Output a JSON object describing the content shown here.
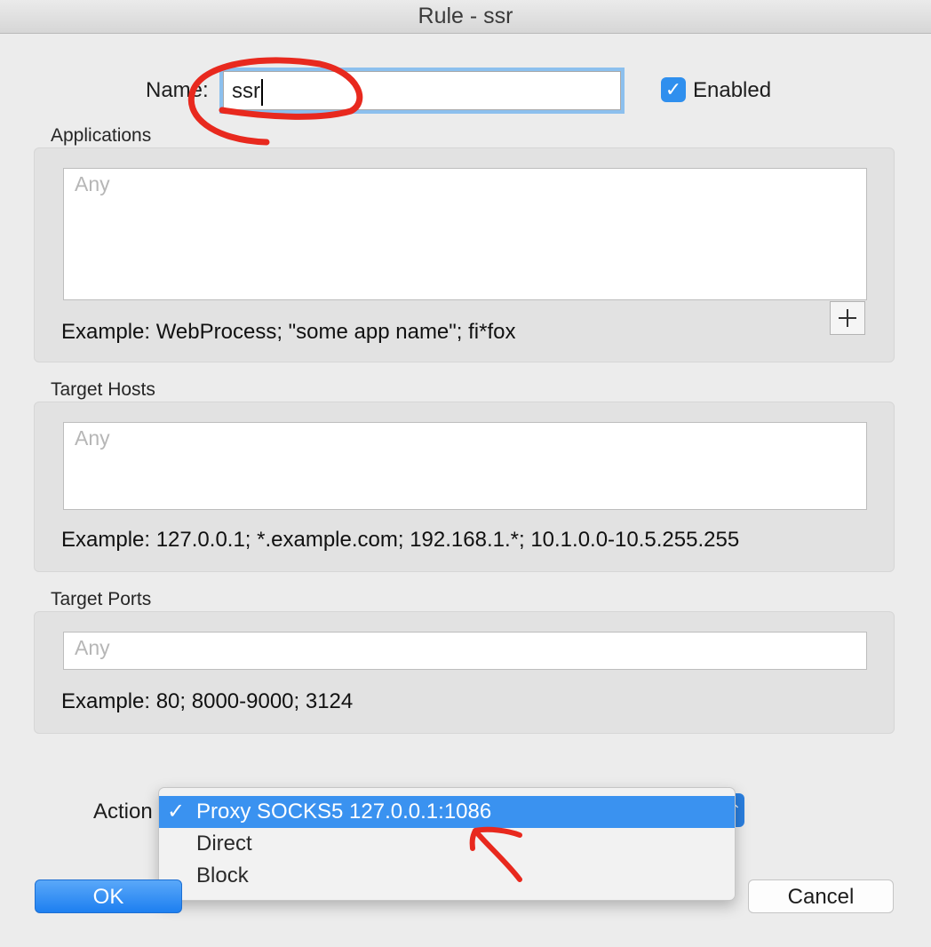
{
  "window": {
    "title": "Rule - ssr"
  },
  "form": {
    "name_label": "Name:",
    "name_value": "ssr",
    "enabled_label": "Enabled",
    "enabled_checked": true
  },
  "applications": {
    "heading": "Applications",
    "placeholder": "Any",
    "example": "Example: WebProcess; \"some app name\"; fi*fox"
  },
  "target_hosts": {
    "heading": "Target Hosts",
    "placeholder": "Any",
    "example": "Example: 127.0.0.1; *.example.com; 192.168.1.*; 10.1.0.0-10.5.255.255"
  },
  "target_ports": {
    "heading": "Target Ports",
    "placeholder": "Any",
    "example": "Example: 80; 8000-9000; 3124"
  },
  "action": {
    "label": "Action",
    "check_glyph": "✓",
    "options": [
      "Proxy SOCKS5 127.0.0.1:1086",
      "Direct",
      "Block"
    ],
    "selected_index": 0
  },
  "buttons": {
    "ok": "OK",
    "cancel": "Cancel"
  },
  "colors": {
    "accent_blue": "#3a92f0",
    "annotation_red": "#e8291e"
  },
  "icons": {
    "add": "plus-icon",
    "check": "checkmark-icon",
    "popup": "chevron-updown-icon"
  }
}
